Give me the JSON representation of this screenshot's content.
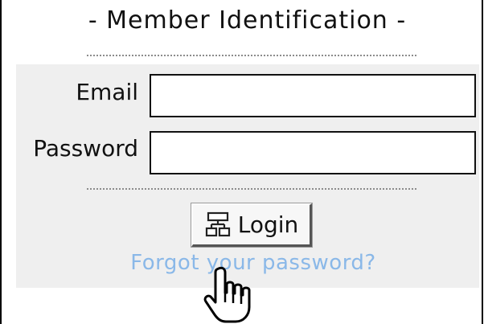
{
  "form": {
    "title": "- Member Identification -",
    "email_label": "Email",
    "password_label": "Password",
    "email_value": "",
    "password_value": "",
    "login_label": "Login",
    "forgot_label": "Forgot your password?"
  },
  "icons": {
    "login": "sitemap-icon",
    "cursor": "hand-pointer-icon"
  },
  "colors": {
    "panel_background": "#efefef",
    "link": "#8ab8e8",
    "border": "#111111"
  }
}
